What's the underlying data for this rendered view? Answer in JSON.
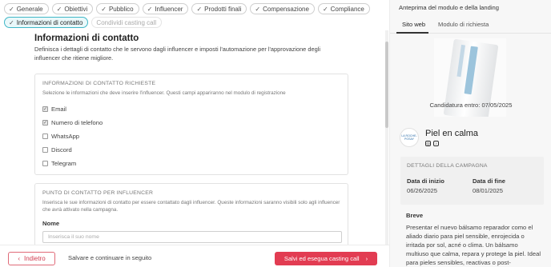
{
  "steps": [
    {
      "label": "Generale",
      "state": "done"
    },
    {
      "label": "Obiettivi",
      "state": "done"
    },
    {
      "label": "Pubblico",
      "state": "done"
    },
    {
      "label": "Influencer",
      "state": "done"
    },
    {
      "label": "Prodotti finali",
      "state": "done"
    },
    {
      "label": "Compensazione",
      "state": "done"
    },
    {
      "label": "Compliance",
      "state": "done"
    },
    {
      "label": "Informazioni di contatto",
      "state": "active"
    },
    {
      "label": "Condividi casting call",
      "state": "disabled"
    }
  ],
  "main": {
    "title": "Informazioni di contatto",
    "description": "Definisca i dettagli di contatto che le servono dagli influencer e imposti l'automazione per l'approvazione degli influencer che ritiene migliore."
  },
  "required_info": {
    "title": "INFORMAZIONI DI CONTATTO RICHIESTE",
    "subtitle": "Selezione le informazioni che deve inserire l'influencer. Questi campi appariranno nel modulo di registrazione",
    "options": [
      {
        "label": "Email",
        "checked": true
      },
      {
        "label": "Numero di telefono",
        "checked": true
      },
      {
        "label": "WhatsApp",
        "checked": false
      },
      {
        "label": "Discord",
        "checked": false
      },
      {
        "label": "Telegram",
        "checked": false
      }
    ]
  },
  "contact_point": {
    "title": "PUNTO DI CONTATTO PER INFLUENCER",
    "subtitle": "Inserisca le sue informazioni di contatto per essere contattato dagli influencer. Queste informazioni saranno visibili solo agli influencer che avrà attivato nella campagna.",
    "name_label": "Nome",
    "name_placeholder": "Inserisca il suo nome",
    "name_value": ""
  },
  "footer": {
    "back_label": "Indietro",
    "save_later_label": "Salvare e continuare in seguito",
    "primary_label": "Salvi ed esegua casting call"
  },
  "preview": {
    "title": "Anteprima del modulo e della landing",
    "tabs": [
      "Sito web",
      "Modulo di richiesta"
    ],
    "active_tab": "Sito web",
    "deadline": "Candidatura entro: 07/05/2025",
    "logo_text": "LA ROCHE-POSAY",
    "brand_name": "Piel en calma",
    "social_icons": [
      "instagram-icon",
      "tiktok-icon"
    ],
    "details_title": "DETTAGLI DELLA CAMPAGNA",
    "start_label": "Data di inizio",
    "start_value": "06/26/2025",
    "end_label": "Data di fine",
    "end_value": "08/01/2025",
    "brief_label": "Breve",
    "brief_text": "Presentar el nuevo bálsamo reparador como el aliado diario para piel sensible, enrojecida o irritada por sol, acné o clima. Un bálsamo multiuso que calma, repara y protege la piel. Ideal para pieles sensibles, reactivas o post-"
  },
  "colors": {
    "accent": "#e23c52",
    "active_step_border": "#3fb7c7",
    "active_step_bg": "#e9f8fa"
  }
}
